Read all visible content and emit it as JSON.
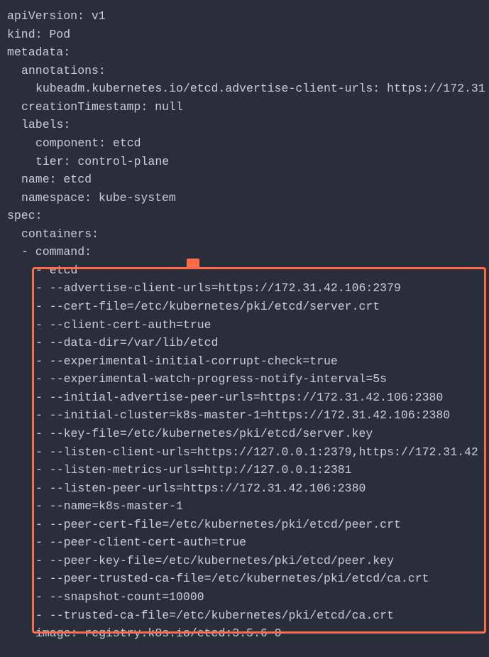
{
  "yaml": {
    "apiVersion": "apiVersion: v1",
    "kind": "kind: Pod",
    "metadata": "metadata:",
    "annotations": "annotations:",
    "annotationValue": "kubeadm.kubernetes.io/etcd.advertise-client-urls: https://172.31",
    "creationTimestamp": "creationTimestamp: null",
    "labels": "labels:",
    "component": "component: etcd",
    "tier": "tier: control-plane",
    "name": "name: etcd",
    "namespace": "namespace: kube-system",
    "spec": "spec:",
    "containers": "containers:",
    "command": "- command:",
    "cmd_etcd": "- etcd",
    "cmd_advertise": "- --advertise-client-urls=https://172.31.42.106:2379",
    "cmd_certfile": "- --cert-file=/etc/kubernetes/pki/etcd/server.crt",
    "cmd_clientauth": "- --client-cert-auth=true",
    "cmd_datadir": "- --data-dir=/var/lib/etcd",
    "cmd_expcorrupt": "- --experimental-initial-corrupt-check=true",
    "cmd_expwatch": "- --experimental-watch-progress-notify-interval=5s",
    "cmd_initadv": "- --initial-advertise-peer-urls=https://172.31.42.106:2380",
    "cmd_initcluster": "- --initial-cluster=k8s-master-1=https://172.31.42.106:2380",
    "cmd_keyfile": "- --key-file=/etc/kubernetes/pki/etcd/server.key",
    "cmd_listenclient": "- --listen-client-urls=https://127.0.0.1:2379,https://172.31.42",
    "cmd_listenmetrics": "- --listen-metrics-urls=http://127.0.0.1:2381",
    "cmd_listenpeer": "- --listen-peer-urls=https://172.31.42.106:2380",
    "cmd_name": "- --name=k8s-master-1",
    "cmd_peercert": "- --peer-cert-file=/etc/kubernetes/pki/etcd/peer.crt",
    "cmd_peerauth": "- --peer-client-cert-auth=true",
    "cmd_peerkey": "- --peer-key-file=/etc/kubernetes/pki/etcd/peer.key",
    "cmd_peerca": "- --peer-trusted-ca-file=/etc/kubernetes/pki/etcd/ca.crt",
    "cmd_snapshot": "- --snapshot-count=10000",
    "cmd_trustedca": "- --trusted-ca-file=/etc/kubernetes/pki/etcd/ca.crt",
    "image": "image: registry.k8s.io/etcd:3.5.6-0"
  }
}
